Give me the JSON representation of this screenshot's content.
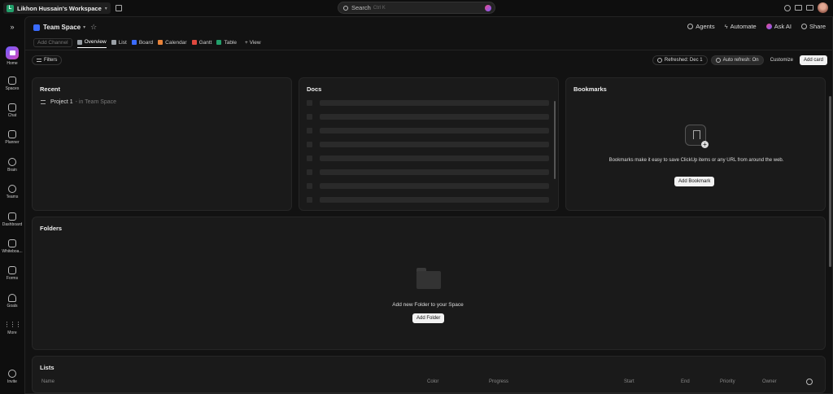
{
  "workspace": {
    "initial": "L",
    "name": "Likhon Hussain's Workspace"
  },
  "search": {
    "label": "Search",
    "shortcut": "Ctrl K"
  },
  "rail": [
    {
      "label": "Home"
    },
    {
      "label": "Spaces"
    },
    {
      "label": "Chat"
    },
    {
      "label": "Planner"
    },
    {
      "label": "Brain"
    },
    {
      "label": "Teams"
    },
    {
      "label": "Dashboard"
    },
    {
      "label": "Whiteboa..."
    },
    {
      "label": "Forms"
    },
    {
      "label": "Goals"
    },
    {
      "label": "More"
    },
    {
      "label": "Invite"
    }
  ],
  "space": {
    "name": "Team Space"
  },
  "header_actions": {
    "agents": "Agents",
    "automate": "Automate",
    "ask_ai": "Ask AI",
    "share": "Share"
  },
  "tabs": {
    "add_channel": "Add Channel",
    "items": [
      {
        "label": "Overview",
        "color": "#9aa0a6"
      },
      {
        "label": "List",
        "color": "#9aa0a6"
      },
      {
        "label": "Board",
        "color": "#3a6bff"
      },
      {
        "label": "Calendar",
        "color": "#e8833a"
      },
      {
        "label": "Gantt",
        "color": "#e0483e"
      },
      {
        "label": "Table",
        "color": "#22a06b"
      }
    ],
    "add_view": "+ View"
  },
  "toolbar": {
    "filters": "Filters",
    "refreshed": "Refreshed: Dec 1",
    "auto_refresh": "Auto refresh: On",
    "customize": "Customize",
    "add_card": "Add card"
  },
  "recent": {
    "title": "Recent",
    "item_name": "Project 1",
    "item_location": "- in Team Space"
  },
  "docs": {
    "title": "Docs"
  },
  "bookmarks": {
    "title": "Bookmarks",
    "text": "Bookmarks make it easy to save ClickUp items or any URL from around the web.",
    "button": "Add Bookmark"
  },
  "folders": {
    "title": "Folders",
    "text": "Add new Folder to your Space",
    "button": "Add Folder"
  },
  "lists": {
    "title": "Lists",
    "columns": [
      "Name",
      "Color",
      "Progress",
      "Start",
      "End",
      "Priority",
      "Owner"
    ]
  }
}
